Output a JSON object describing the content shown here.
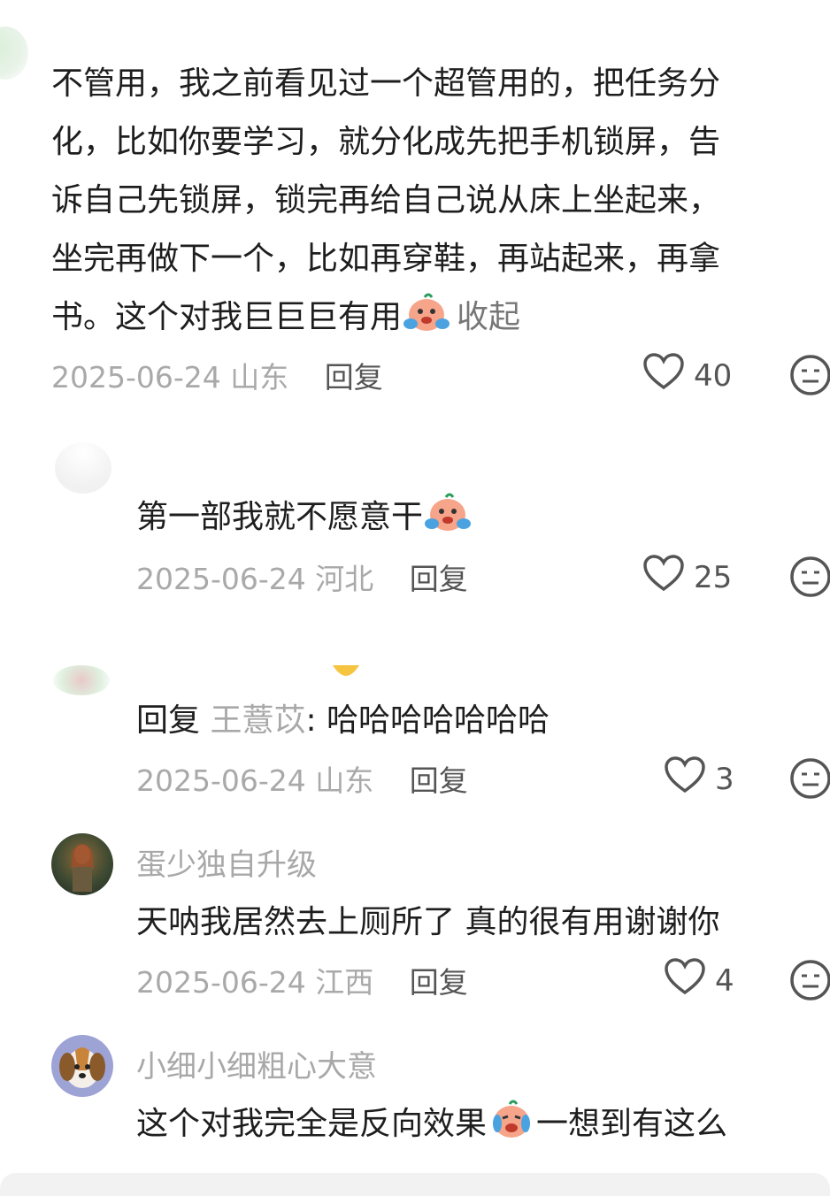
{
  "comments": [
    {
      "text": "不管用，我之前看见过一个超管用的，把任务分化，比如你要学习，就分化成先把手机锁屏，告诉自己先锁屏，锁完再给自己说从床上坐起来，坐完再做下一个，比如再穿鞋，再站起来，再拿书。这个对我巨巨巨有用",
      "lines": [
        "不管用，我之前看见过一个超管用的，把任务分",
        "化，比如你要学习，就分化成先把手机锁屏，告",
        "诉自己先锁屏，锁完再给自己说从床上坐起来，",
        "坐完再做下一个，比如再穿鞋，再站起来，再拿",
        "书。这个对我巨巨巨有用"
      ],
      "collapse": "收起",
      "date": "2025-06-24",
      "location": "山东",
      "reply": "回复",
      "likes": "40"
    },
    {
      "text": "第一部我就不愿意干",
      "date": "2025-06-24",
      "location": "河北",
      "reply": "回复",
      "likes": "25"
    },
    {
      "reply_prefix": "回复",
      "reply_to": "王薏苡",
      "text": ": 哈哈哈哈哈哈哈",
      "date": "2025-06-24",
      "location": "山东",
      "reply": "回复",
      "likes": "3"
    },
    {
      "username": "蛋少独自升级",
      "text": "天呐我居然去上厕所了 真的很有用谢谢你",
      "date": "2025-06-24",
      "location": "江西",
      "reply": "回复",
      "likes": "4"
    },
    {
      "username": "小细小细粗心大意",
      "text": "这个对我完全是反向效果",
      "text_after": "一想到有这么"
    }
  ],
  "icons": {
    "like": "heart-outline-icon",
    "dislike": "meh-face-icon",
    "emoji": "crying-face-emoji"
  },
  "colors": {
    "text": "#1e1e1e",
    "meta": "#a9a9a9",
    "username": "#a8a8a8"
  }
}
